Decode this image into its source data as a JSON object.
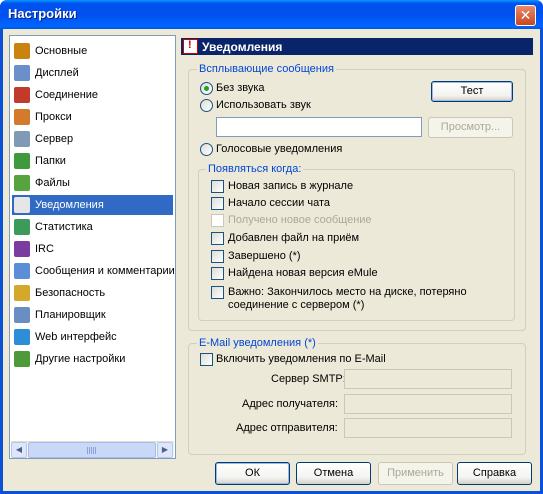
{
  "window": {
    "title": "Настройки",
    "close": "✕"
  },
  "nav": {
    "items": [
      {
        "label": "Основные",
        "icon": "gear-icon",
        "color": "#c9830e"
      },
      {
        "label": "Дисплей",
        "icon": "display-icon",
        "color": "#6b8fc9"
      },
      {
        "label": "Соединение",
        "icon": "connection-icon",
        "color": "#c23a2a"
      },
      {
        "label": "Прокси",
        "icon": "proxy-icon",
        "color": "#d47a2c"
      },
      {
        "label": "Сервер",
        "icon": "server-icon",
        "color": "#7e9ab5"
      },
      {
        "label": "Папки",
        "icon": "folder-icon",
        "color": "#3f9a3c"
      },
      {
        "label": "Файлы",
        "icon": "files-icon",
        "color": "#57a43f"
      },
      {
        "label": "Уведомления",
        "icon": "notification-icon",
        "color": "#e6e6e6"
      },
      {
        "label": "Статистика",
        "icon": "statistics-icon",
        "color": "#3c9a5a"
      },
      {
        "label": "IRC",
        "icon": "irc-icon",
        "color": "#7a3c9e"
      },
      {
        "label": "Сообщения и комментарии",
        "icon": "messages-icon",
        "color": "#5a8fd8"
      },
      {
        "label": "Безопасность",
        "icon": "lock-icon",
        "color": "#d4a82a"
      },
      {
        "label": "Планировщик",
        "icon": "scheduler-icon",
        "color": "#6a8ec4"
      },
      {
        "label": "Web интерфейс",
        "icon": "globe-icon",
        "color": "#2c8ed6"
      },
      {
        "label": "Другие настройки",
        "icon": "settings-icon",
        "color": "#4e9a3a"
      }
    ],
    "selected_index": 7
  },
  "panel": {
    "title": "Уведомления",
    "popups": {
      "title": "Всплывающие сообщения",
      "no_sound": "Без звука",
      "use_sound": "Использовать звук",
      "test_button": "Тест",
      "browse_button": "Просмотр...",
      "sound_path": "",
      "voice": "Голосовые уведомления",
      "selected": "no_sound"
    },
    "when": {
      "title": "Появляться когда:",
      "items": [
        {
          "label": "Новая запись в журнале",
          "checked": false,
          "disabled": false
        },
        {
          "label": "Начало сессии чата",
          "checked": false,
          "disabled": false
        },
        {
          "label": "Получено новое сообщение",
          "checked": false,
          "disabled": true
        },
        {
          "label": "Добавлен файл на приём",
          "checked": false,
          "disabled": false
        },
        {
          "label": "Завершено (*)",
          "checked": false,
          "disabled": false
        },
        {
          "label": "Найдена новая версия eMule",
          "checked": false,
          "disabled": false
        },
        {
          "label": "Важно: Закончилось место на диске, потеряно",
          "label2": "соединение с сервером (*)",
          "checked": false,
          "disabled": false
        }
      ]
    },
    "email": {
      "title": "E-Mail уведомления (*)",
      "enable": "Включить уведомления по E-Mail",
      "smtp_label": "Сервер SMTP:",
      "recipient_label": "Адрес получателя:",
      "sender_label": "Адрес отправителя:",
      "smtp_value": "",
      "recipient_value": "",
      "sender_value": ""
    }
  },
  "footer": {
    "ok": "ОК",
    "cancel": "Отмена",
    "apply": "Применить",
    "help": "Справка"
  }
}
